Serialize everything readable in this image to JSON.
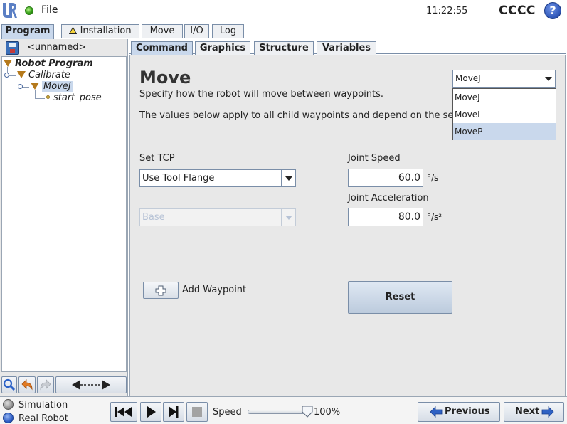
{
  "header": {
    "file_menu": "File",
    "clock": "11:22:55",
    "robot_name": "CCCC",
    "help_glyph": "?"
  },
  "main_tabs": [
    {
      "label": "Program",
      "active": true
    },
    {
      "label": "Installation",
      "active": false,
      "icon": "warning-icon"
    },
    {
      "label": "Move",
      "active": false
    },
    {
      "label": "I/O",
      "active": false
    },
    {
      "label": "Log",
      "active": false
    }
  ],
  "left_panel": {
    "program_name": "<unnamed>",
    "tree": [
      {
        "label": "Robot Program",
        "level": 0,
        "bold": true
      },
      {
        "label": "Calibrate",
        "level": 1
      },
      {
        "label": "MoveJ",
        "level": 2,
        "selected": true
      },
      {
        "label": "start_pose",
        "level": 3,
        "waypoint": true
      }
    ],
    "toolbar_icons": [
      "search-icon",
      "undo-icon",
      "redo-icon",
      "drag-arrows-icon"
    ]
  },
  "sub_tabs": [
    {
      "label": "Command",
      "active": true
    },
    {
      "label": "Graphics",
      "active": false
    },
    {
      "label": "Structure",
      "active": false
    },
    {
      "label": "Variables",
      "active": false
    }
  ],
  "command": {
    "title": "Move",
    "description": "Specify how the robot will move between waypoints.",
    "note": "The values below apply to all child waypoints and depend on the selected move type.",
    "move_type": {
      "selected": "MoveJ",
      "options": [
        "MoveJ",
        "MoveL",
        "MoveP"
      ],
      "highlighted": "MoveP"
    },
    "tcp_label": "Set TCP",
    "tcp_value": "Use Tool Flange",
    "feature_value": "Base",
    "joint_speed_label": "Joint Speed",
    "joint_speed_value": "60.0",
    "joint_speed_unit": "°/s",
    "joint_accel_label": "Joint Acceleration",
    "joint_accel_value": "80.0",
    "joint_accel_unit": "°/s²",
    "add_waypoint_label": "Add Waypoint",
    "reset_label": "Reset"
  },
  "footer": {
    "simulation_label": "Simulation",
    "real_robot_label": "Real Robot",
    "speed_label": "Speed",
    "speed_value": "100%",
    "speed_fraction": 1.0,
    "previous_label": "Previous",
    "next_label": "Next"
  },
  "colors": {
    "active_tab": "#c9d8ec",
    "tree_triangle": "#b5791b",
    "accent_blue": "#2e56b8",
    "status_green": "#37a01a"
  }
}
